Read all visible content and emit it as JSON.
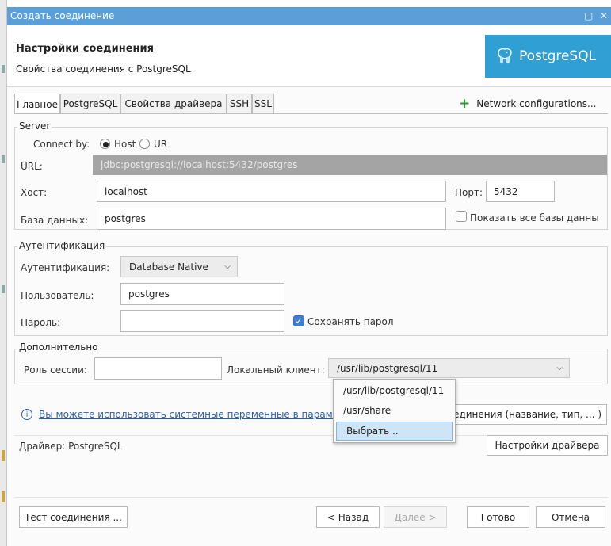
{
  "window": {
    "title": "Создать соединение",
    "controls": [
      "▢",
      "✕"
    ]
  },
  "header": {
    "title": "Настройки соединения",
    "subtitle": "Свойства соединения с PostgreSQL",
    "logo_text": "PostgreSQL",
    "logo_color": "#2f9fd4"
  },
  "tabs": [
    {
      "label": "Главное",
      "active": true
    },
    {
      "label": "PostgreSQL",
      "active": false
    },
    {
      "label": "Свойства драйвера",
      "active": false
    },
    {
      "label": "SSH",
      "active": false
    },
    {
      "label": "SSL",
      "active": false
    }
  ],
  "network_config": {
    "label": "Network configurations..."
  },
  "server": {
    "group_title": "Server",
    "connect_by_label": "Connect by:",
    "host_option": "Host",
    "url_option": "UR",
    "url_label": "URL:",
    "url_value": "jdbc:postgresql://localhost:5432/postgres",
    "host_label": "Хост:",
    "host_value": "localhost",
    "port_label": "Порт:",
    "port_value": "5432",
    "db_label": "База данных:",
    "db_value": "postgres",
    "show_all_label": "Показать все базы данны"
  },
  "auth": {
    "group_title": "Аутентификация",
    "method_label": "Аутентификация:",
    "method_value": "Database Native",
    "user_label": "Пользователь:",
    "user_value": "postgres",
    "password_label": "Пароль:",
    "password_value": "",
    "save_password_label": "Сохранять парол"
  },
  "extra": {
    "group_title": "Дополнительно",
    "session_role_label": "Роль сессии:",
    "session_role_value": "",
    "local_client_label": "Локальный клиент:",
    "local_client_value": "/usr/lib/postgresql/11",
    "local_client_options": [
      "/usr/lib/postgresql/11",
      "/usr/share",
      "Выбрать .."
    ]
  },
  "info": {
    "icon": "info-icon",
    "link_text": "Вы можете использовать системные переменные в параме",
    "button_text": "единения (название, тип, ... )"
  },
  "driver": {
    "label": "Драйвер: PostgreSQL",
    "settings_button": "Настройки драйвера"
  },
  "footer": {
    "test_button": "Тест соединения ...",
    "back_button": "< Назад",
    "next_button": "Далее >",
    "finish_button": "Готово",
    "cancel_button": "Отмена"
  }
}
